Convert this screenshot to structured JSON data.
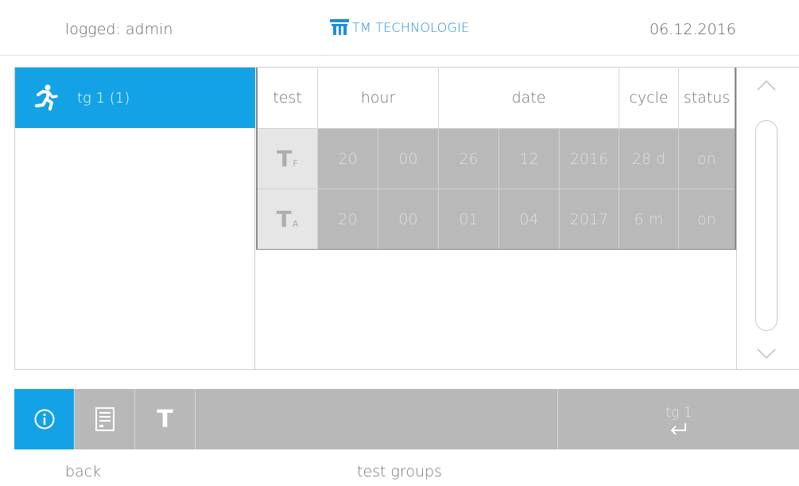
{
  "header": {
    "user": "logged: admin",
    "brand": "TM TECHNOLOGIE",
    "date": "06.12.2016",
    "brand_color": "#1f8fd6"
  },
  "sidebar": {
    "items": [
      {
        "label": "tg 1 (1)",
        "icon": "running-man-icon",
        "selected": true
      }
    ],
    "accent": "#14a2e6"
  },
  "table": {
    "headers": [
      "test",
      "hour",
      "date",
      "cycle",
      "status"
    ],
    "rows": [
      {
        "type": "T",
        "sub": "F",
        "hour": "20",
        "minute": "00",
        "day": "26",
        "month": "12",
        "year": "2016",
        "cycle": "28 d",
        "status": "on"
      },
      {
        "type": "T",
        "sub": "A",
        "hour": "20",
        "minute": "00",
        "day": "01",
        "month": "04",
        "year": "2017",
        "cycle": "6 m",
        "status": "on"
      }
    ]
  },
  "scrollbar": {
    "up_icon": "chevron-up-icon",
    "down_icon": "chevron-down-icon"
  },
  "toolbar": {
    "info_icon": "info-icon",
    "list_icon": "list-icon",
    "t_label": "T",
    "enter_label": "tg 1",
    "enter_icon": "enter-icon"
  },
  "footer": {
    "back": "back",
    "title": "test groups"
  }
}
